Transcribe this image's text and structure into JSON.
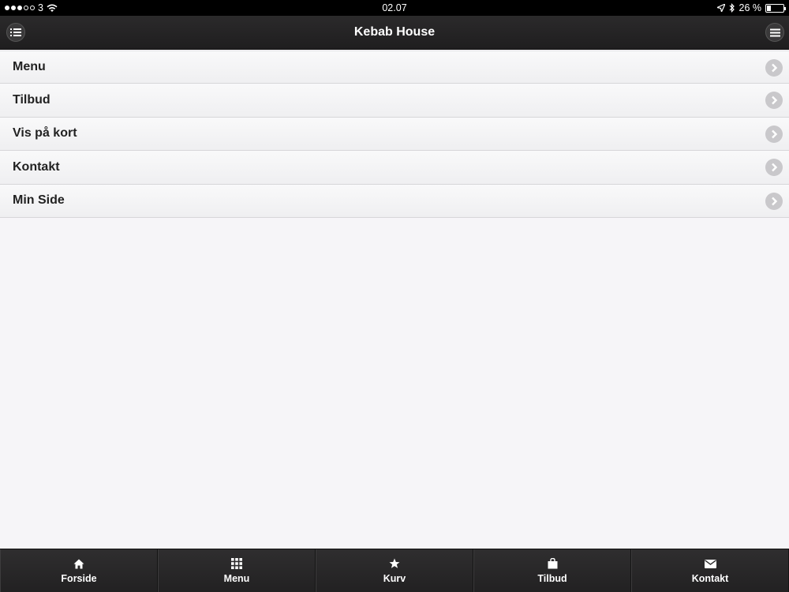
{
  "status": {
    "carrier": "3",
    "time": "02.07",
    "battery_text": "26 %",
    "battery_level": 0.26
  },
  "header": {
    "title": "Kebab House",
    "left_icon": "list-icon",
    "right_icon": "hamburger-menu-icon"
  },
  "list": {
    "items": [
      {
        "label": "Menu"
      },
      {
        "label": "Tilbud"
      },
      {
        "label": "Vis på kort"
      },
      {
        "label": "Kontakt"
      },
      {
        "label": "Min Side"
      }
    ]
  },
  "tabbar": {
    "tabs": [
      {
        "label": "Forside",
        "icon": "home-icon"
      },
      {
        "label": "Menu",
        "icon": "grid-icon"
      },
      {
        "label": "Kurv",
        "icon": "star-icon"
      },
      {
        "label": "Tilbud",
        "icon": "shopping-bag-icon"
      },
      {
        "label": "Kontakt",
        "icon": "mail-icon"
      }
    ]
  }
}
